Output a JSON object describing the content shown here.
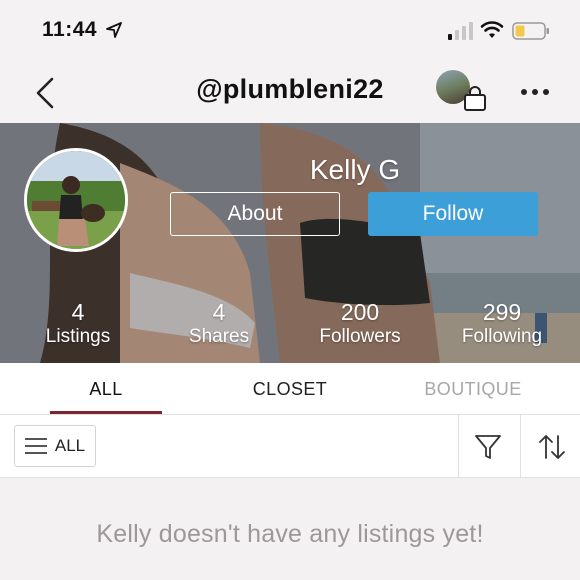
{
  "status_bar": {
    "time": "11:44"
  },
  "nav": {
    "username": "@plumbleni22"
  },
  "profile": {
    "display_name": "Kelly G",
    "about_label": "About",
    "follow_label": "Follow",
    "stats": [
      {
        "value": "4",
        "label": "Listings"
      },
      {
        "value": "4",
        "label": "Shares"
      },
      {
        "value": "200",
        "label": "Followers"
      },
      {
        "value": "299",
        "label": "Following"
      }
    ]
  },
  "tabs": [
    {
      "label": "ALL"
    },
    {
      "label": "CLOSET"
    },
    {
      "label": "BOUTIQUE"
    }
  ],
  "filter_bar": {
    "all_label": "ALL"
  },
  "empty_state": {
    "message": "Kelly doesn't have any listings yet!"
  },
  "colors": {
    "accent_blue": "#3d9fd8",
    "tab_underline": "#7b2630",
    "battery_fill": "#f2c94c"
  },
  "icons": [
    "location-arrow-icon",
    "signal-icon",
    "wifi-icon",
    "battery-icon",
    "back-chevron-icon",
    "shopping-bag-icon",
    "more-icon",
    "hamburger-icon",
    "filter-funnel-icon",
    "sort-arrows-icon"
  ]
}
